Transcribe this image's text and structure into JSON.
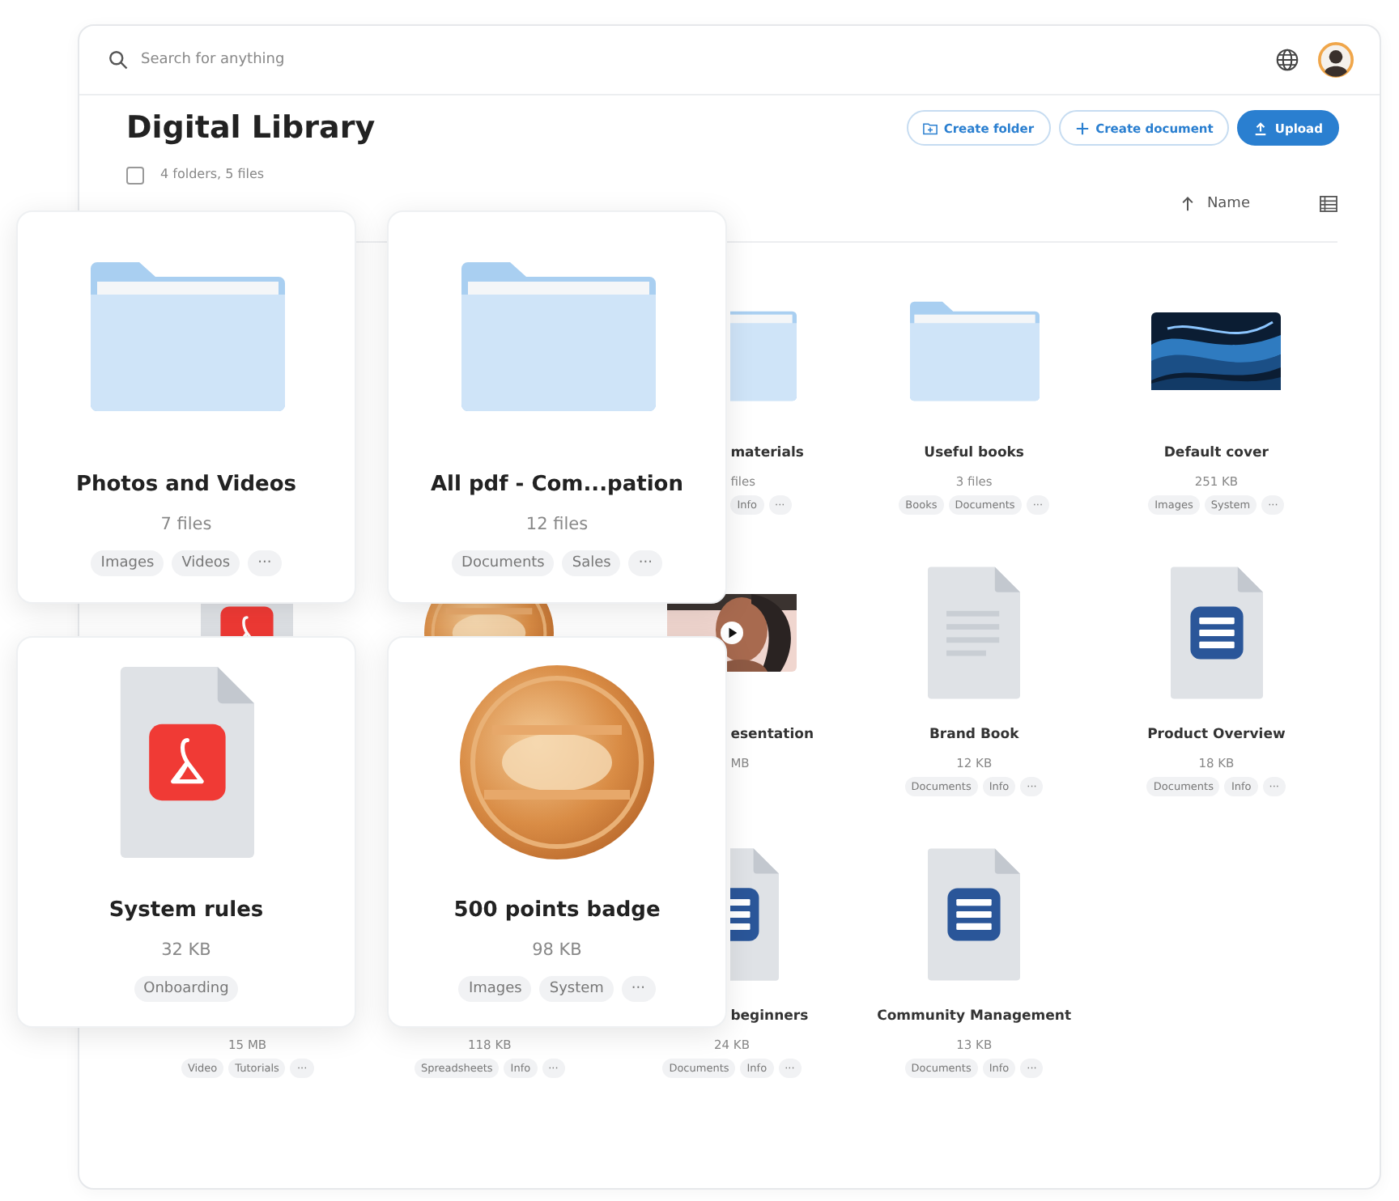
{
  "search": {
    "placeholder": "Search for anything"
  },
  "title": "Digital Library",
  "actions": [
    {
      "label": "Create folder",
      "kind": "folder"
    },
    {
      "label": "Create document",
      "kind": "plus"
    },
    {
      "label": "Upload",
      "kind": "upload"
    }
  ],
  "summary": {
    "checked": false,
    "text": "4 folders, 5 files"
  },
  "sort": {
    "label": "Name"
  },
  "rows": [
    {
      "items": [
        {
          "kind": "folder",
          "title": "materials",
          "size": "files",
          "tags": [
            "Info"
          ],
          "more": "···"
        },
        {
          "kind": "folder",
          "title": "Useful books",
          "size": "3 files",
          "tags": [
            "Books",
            "Documents"
          ],
          "more": "···"
        },
        {
          "title": "Default cover",
          "size": "251 KB",
          "tags": [
            "Images",
            "System"
          ],
          "more": "···"
        }
      ]
    },
    {
      "items": [
        {
          "kind": "pdf"
        },
        {
          "kind": "badge"
        },
        {
          "kind": "video",
          "title": "esentation",
          "size": "MB"
        },
        {
          "kind": "text-doc",
          "title": "Brand Book",
          "size": "12 KB",
          "tags": [
            "Documents",
            "Info"
          ],
          "more": "···"
        },
        {
          "kind": "doc",
          "title": "Product Overview",
          "size": "18 KB",
          "tags": [
            "Documents",
            "Info"
          ],
          "more": "···"
        }
      ]
    },
    {
      "items": [
        {
          "size": "15 MB",
          "tags": [
            "Video",
            "Tutorials"
          ],
          "more": "···"
        },
        {
          "size": "118 KB",
          "tags": [
            "Spreadsheets",
            "Info"
          ],
          "more": "···"
        },
        {
          "kind": "doc",
          "title": "beginners",
          "size": "24 KB",
          "tags": [
            "Documents",
            "Info"
          ],
          "more": "···"
        },
        {
          "kind": "doc",
          "title": "Community Management",
          "size": "13 KB",
          "tags": [
            "Documents",
            "Info"
          ],
          "more": "···"
        }
      ]
    }
  ],
  "cards": [
    {
      "kind": "folder",
      "title": "Photos and Videos",
      "size": "7 files",
      "tags": [
        "Images",
        "Videos"
      ],
      "more": "···"
    },
    {
      "kind": "folder",
      "title": "All pdf - Com...pation",
      "size": "12 files",
      "tags": [
        "Documents",
        "Sales"
      ],
      "more": "···"
    },
    {
      "kind": "pdf",
      "title": "System rules",
      "size": "32 KB",
      "tags": [
        "Onboarding"
      ]
    },
    {
      "kind": "badge",
      "title": "500 points badge",
      "size": "98 KB",
      "tags": [
        "Images",
        "System"
      ],
      "more": "···"
    }
  ]
}
